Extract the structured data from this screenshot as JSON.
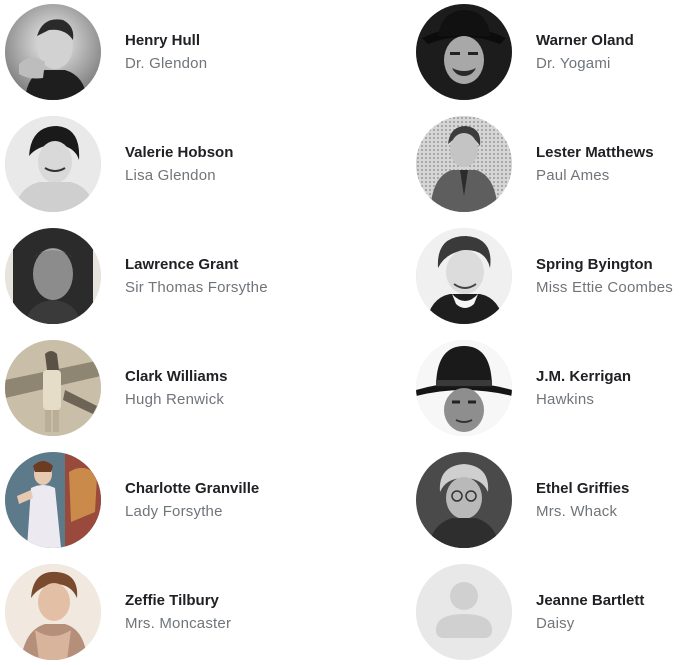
{
  "cast": {
    "left": [
      {
        "name": "Henry Hull",
        "role": "Dr. Glendon",
        "avatar_icon": "portrait-photo-henry-hull"
      },
      {
        "name": "Valerie Hobson",
        "role": "Lisa Glendon",
        "avatar_icon": "portrait-photo-valerie-hobson"
      },
      {
        "name": "Lawrence Grant",
        "role": "Sir Thomas Forsythe",
        "avatar_icon": "portrait-photo-lawrence-grant"
      },
      {
        "name": "Clark Williams",
        "role": "Hugh Renwick",
        "avatar_icon": "portrait-photo-clark-williams"
      },
      {
        "name": "Charlotte Granville",
        "role": "Lady Forsythe",
        "avatar_icon": "portrait-photo-charlotte-granville"
      },
      {
        "name": "Zeffie Tilbury",
        "role": "Mrs. Moncaster",
        "avatar_icon": "portrait-photo-zeffie-tilbury"
      }
    ],
    "right": [
      {
        "name": "Warner Oland",
        "role": "Dr. Yogami",
        "avatar_icon": "portrait-photo-warner-oland"
      },
      {
        "name": "Lester Matthews",
        "role": "Paul Ames",
        "avatar_icon": "portrait-photo-lester-matthews"
      },
      {
        "name": "Spring Byington",
        "role": "Miss Ettie Coombes",
        "avatar_icon": "portrait-photo-spring-byington"
      },
      {
        "name": "J.M. Kerrigan",
        "role": "Hawkins",
        "avatar_icon": "portrait-photo-jm-kerrigan"
      },
      {
        "name": "Ethel Griffies",
        "role": "Mrs. Whack",
        "avatar_icon": "portrait-photo-ethel-griffies"
      },
      {
        "name": "Jeanne Bartlett",
        "role": "Daisy",
        "avatar_icon": "default-person-icon"
      }
    ]
  },
  "colors": {
    "name_text": "#202124",
    "role_text": "#70757a",
    "placeholder_bg": "#e8e8e8",
    "placeholder_fg": "#d0d0d0"
  }
}
